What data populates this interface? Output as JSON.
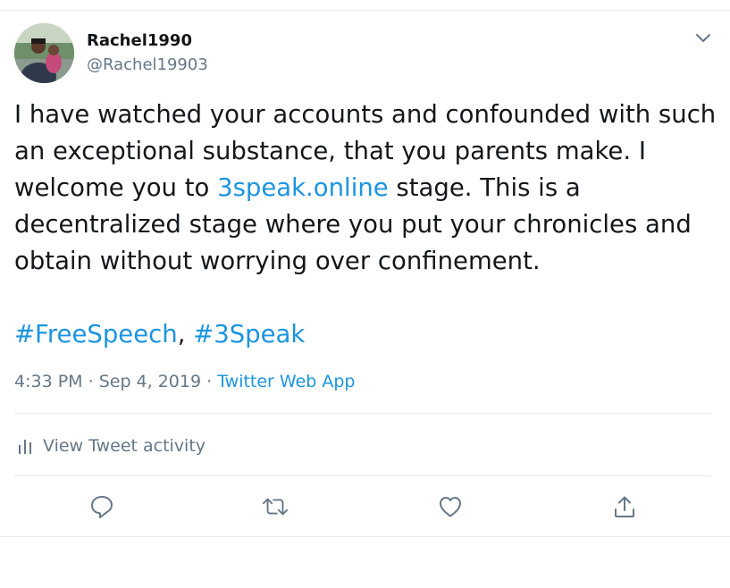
{
  "user": {
    "display_name": "Rachel1990",
    "handle": "@Rachel19903"
  },
  "tweet": {
    "paragraph1_before_link": "I have watched your accounts and confounded with such an exceptional substance, that you parents make. I welcome you to ",
    "link_text": "3speak.online",
    "paragraph1_after_link": " stage. This is a decentralized stage where you put your chronicles and obtain without worrying over confinement.",
    "hashtag1": "#FreeSpeech",
    "separator": ", ",
    "hashtag2": "#3Speak"
  },
  "meta": {
    "time": "4:33 PM",
    "dot1": " · ",
    "date": "Sep 4, 2019",
    "dot2": " · ",
    "source": "Twitter Web App"
  },
  "activity": {
    "label": "View Tweet activity",
    "icon": "bar-chart-icon"
  },
  "actions": {
    "reply_icon": "reply-icon",
    "retweet_icon": "retweet-icon",
    "like_icon": "heart-icon",
    "share_icon": "share-icon",
    "more_icon": "chevron-down-icon"
  },
  "colors": {
    "link": "#1b95e0",
    "muted": "#657786",
    "text": "#14171a",
    "divider": "#e6ecf0"
  }
}
